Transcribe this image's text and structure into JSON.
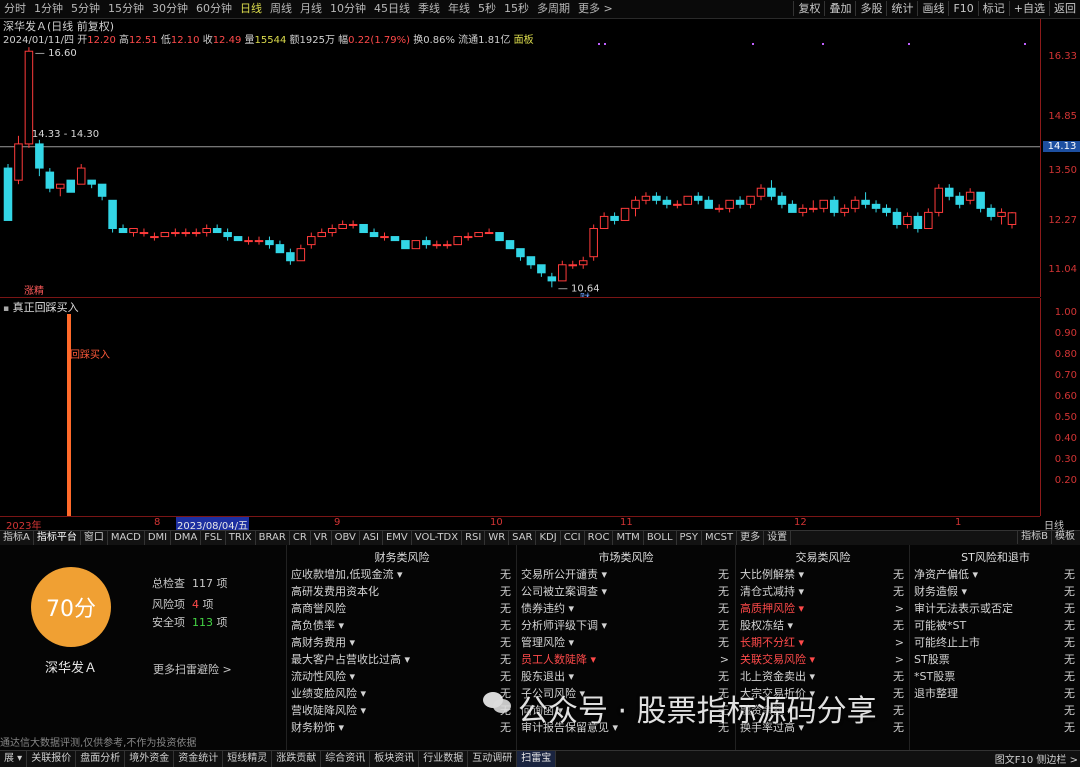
{
  "toolbar": {
    "periods": [
      "分时",
      "1分钟",
      "5分钟",
      "15分钟",
      "30分钟",
      "60分钟",
      "日线",
      "周线",
      "月线",
      "10分钟",
      "45日线",
      "季线",
      "年线",
      "5秒",
      "15秒",
      "多周期",
      "更多 >"
    ],
    "active_period": 6,
    "right_buttons": [
      "复权",
      "叠加",
      "多股",
      "统计",
      "画线",
      "F10",
      "标记",
      "+自选",
      "返回"
    ]
  },
  "chart_header": {
    "title": "深华发Ａ(日线 前复权)",
    "date": "2024/01/11/四",
    "open_label": "开",
    "open": "12.20",
    "high_label": "高",
    "high": "12.51",
    "low_label": "低",
    "low": "12.10",
    "close_label": "收",
    "close": "12.49",
    "volume_label": "量",
    "volume": "15544",
    "amount_label": "额",
    "amount": "1925万",
    "change_label": "幅",
    "change": "0.22(1.79%)",
    "turnover_label": "换",
    "turnover": "0.86%",
    "float_label": "流通",
    "float_value": "1.81亿",
    "board": "面板"
  },
  "price_axis": {
    "ticks": [
      "16.33",
      "14.85",
      "13.50",
      "12.27",
      "11.04"
    ],
    "current_price": "14.13"
  },
  "annotations": {
    "high_label": "16.60",
    "line_label": "14.33 - 14.30",
    "low_label": "10.64",
    "low_badge": "财",
    "limit_up_badge": "涨精"
  },
  "indicator": {
    "title": "真正回踩买入",
    "signal_label": "回踩买入",
    "axis_ticks": [
      "1.00",
      "0.90",
      "0.80",
      "0.70",
      "0.60",
      "0.50",
      "0.40",
      "0.30",
      "0.20"
    ]
  },
  "date_axis": {
    "labels": [
      "2023年",
      "8",
      "9",
      "10",
      "11",
      "12",
      "1"
    ],
    "selected_date": "2023/08/04/五",
    "period_name": "日线"
  },
  "indicator_tabs": [
    "指标A",
    "指标平台",
    "窗口",
    "MACD",
    "DMI",
    "DMA",
    "FSL",
    "TRIX",
    "BRAR",
    "CR",
    "VR",
    "OBV",
    "ASI",
    "EMV",
    "VOL-TDX",
    "RSI",
    "WR",
    "SAR",
    "KDJ",
    "CCI",
    "ROC",
    "MTM",
    "BOLL",
    "PSY",
    "MCST",
    "更多",
    "设置"
  ],
  "indicator_tabs_right": [
    "指标B",
    "模板"
  ],
  "risk": {
    "score": "70分",
    "stock_name": "深华发Ａ",
    "total_label": "总检查",
    "total_value": "117",
    "total_unit": "项",
    "risk_label": "风险项",
    "risk_value": "4",
    "risk_unit": "项",
    "safe_label": "安全项",
    "safe_value": "113",
    "safe_unit": "项",
    "more_label": "更多扫雷避险  >",
    "disclaimer": "通达信大数据评测,仅供参考,不作为投资依据",
    "columns": [
      {
        "title": "财务类风险",
        "rows": [
          {
            "label": "应收款增加,低现金流 ▾",
            "value": "无",
            "red": false
          },
          {
            "label": "高研发费用资本化",
            "value": "无",
            "red": false
          },
          {
            "label": "高商誉风险",
            "value": "无",
            "red": false
          },
          {
            "label": "高负债率 ▾",
            "value": "无",
            "red": false
          },
          {
            "label": "高财务费用 ▾",
            "value": "无",
            "red": false
          },
          {
            "label": "最大客户占营收比过高 ▾",
            "value": "无",
            "red": false
          },
          {
            "label": "流动性风险 ▾",
            "value": "无",
            "red": false
          },
          {
            "label": "业绩变脸风险 ▾",
            "value": "无",
            "red": false
          },
          {
            "label": "营收陡降风险 ▾",
            "value": "无",
            "red": false
          },
          {
            "label": "财务粉饰 ▾",
            "value": "无",
            "red": false
          }
        ]
      },
      {
        "title": "市场类风险",
        "rows": [
          {
            "label": "交易所公开谴责 ▾",
            "value": "无",
            "red": false
          },
          {
            "label": "公司被立案调查 ▾",
            "value": "无",
            "red": false
          },
          {
            "label": "债券违约 ▾",
            "value": "无",
            "red": false
          },
          {
            "label": "分析师评级下调 ▾",
            "value": "无",
            "red": false
          },
          {
            "label": "管理风险 ▾",
            "value": "无",
            "red": false
          },
          {
            "label": "员工人数陡降 ▾",
            "value": ">",
            "red": true
          },
          {
            "label": "股东退出 ▾",
            "value": "无",
            "red": false
          },
          {
            "label": "子公司风险 ▾",
            "value": "无",
            "red": false
          },
          {
            "label": "问询函 ▾",
            "value": "无",
            "red": false
          },
          {
            "label": "审计报告保留意见 ▾",
            "value": "无",
            "red": false
          }
        ]
      },
      {
        "title": "交易类风险",
        "rows": [
          {
            "label": "大比例解禁 ▾",
            "value": "无",
            "red": false
          },
          {
            "label": "清仓式减持 ▾",
            "value": "无",
            "red": false
          },
          {
            "label": "高质押风险 ▾",
            "value": ">",
            "red": true
          },
          {
            "label": "股权冻结 ▾",
            "value": "无",
            "red": false
          },
          {
            "label": "长期不分红 ▾",
            "value": ">",
            "red": true
          },
          {
            "label": "关联交易风险 ▾",
            "value": ">",
            "red": true
          },
          {
            "label": "北上资金卖出 ▾",
            "value": "无",
            "red": false
          },
          {
            "label": "大宗交易折价 ▾",
            "value": "无",
            "red": false
          },
          {
            "label": "融资余额 ▾",
            "value": "无",
            "red": false
          },
          {
            "label": "换手率过高 ▾",
            "value": "无",
            "red": false
          }
        ]
      },
      {
        "title": "ST风险和退市",
        "rows": [
          {
            "label": "净资产偏低 ▾",
            "value": "无",
            "red": false
          },
          {
            "label": "财务造假 ▾",
            "value": "无",
            "red": false
          },
          {
            "label": "审计无法表示或否定",
            "value": "无",
            "red": false
          },
          {
            "label": "可能被*ST",
            "value": "无",
            "red": false
          },
          {
            "label": "可能终止上市",
            "value": "无",
            "red": false
          },
          {
            "label": "ST股票",
            "value": "无",
            "red": false
          },
          {
            "label": "*ST股票",
            "value": "无",
            "red": false
          },
          {
            "label": "退市整理",
            "value": "无",
            "red": false
          },
          {
            "label": "",
            "value": "无",
            "red": false
          },
          {
            "label": "",
            "value": "无",
            "red": false
          }
        ]
      }
    ]
  },
  "bottom_bar": [
    "展 ▾",
    "关联报价",
    "盘面分析",
    "境外资金",
    "资金统计",
    "短线精灵",
    "涨跌贡献",
    "综合资讯",
    "板块资讯",
    "行业数据",
    "互动调研",
    "扫雷宝"
  ],
  "bottom_bar_active": 11,
  "bottom_right": "图文F10  侧边栏 >",
  "watermark": "公众号 · 股票指标源码分享",
  "colors": {
    "up": "#ff3b3b",
    "down": "#33d6e6",
    "score": "#f0a033",
    "axis": "#d23434",
    "selected": "#1d2fa0"
  },
  "chart_data": {
    "type": "candlestick",
    "title": "深华发Ａ(日线 前复权)",
    "ylim": [
      10.4,
      17.3
    ],
    "y_ticks": [
      16.33,
      14.85,
      13.5,
      12.27,
      11.04
    ],
    "candles": [
      [
        13.6,
        13.7,
        12.3,
        12.3
      ],
      [
        13.3,
        14.4,
        13.2,
        14.2
      ],
      [
        14.2,
        16.6,
        14.1,
        16.5
      ],
      [
        14.2,
        14.3,
        13.4,
        13.6
      ],
      [
        13.5,
        13.6,
        13.0,
        13.1
      ],
      [
        13.1,
        13.2,
        12.9,
        13.2
      ],
      [
        13.3,
        13.3,
        13.0,
        13.0
      ],
      [
        13.2,
        13.7,
        13.2,
        13.6
      ],
      [
        13.3,
        13.3,
        13.1,
        13.2
      ],
      [
        13.2,
        13.2,
        12.8,
        12.9
      ],
      [
        12.8,
        12.8,
        12.0,
        12.1
      ],
      [
        12.1,
        12.2,
        12.0,
        12.0
      ],
      [
        12.0,
        12.1,
        11.9,
        12.1
      ],
      [
        12.0,
        12.1,
        11.9,
        12.0
      ],
      [
        11.9,
        12.0,
        11.8,
        11.9
      ],
      [
        11.9,
        12.0,
        11.9,
        12.0
      ],
      [
        12.0,
        12.1,
        11.9,
        12.0
      ],
      [
        12.0,
        12.1,
        11.9,
        12.0
      ],
      [
        12.0,
        12.1,
        11.9,
        12.0
      ],
      [
        12.0,
        12.2,
        11.9,
        12.1
      ],
      [
        12.1,
        12.2,
        12.0,
        12.0
      ],
      [
        12.0,
        12.1,
        11.8,
        11.9
      ],
      [
        11.9,
        11.9,
        11.8,
        11.8
      ],
      [
        11.8,
        11.9,
        11.7,
        11.8
      ],
      [
        11.8,
        11.9,
        11.7,
        11.8
      ],
      [
        11.8,
        11.9,
        11.6,
        11.7
      ],
      [
        11.7,
        11.8,
        11.5,
        11.5
      ],
      [
        11.5,
        11.6,
        11.2,
        11.3
      ],
      [
        11.3,
        11.7,
        11.3,
        11.6
      ],
      [
        11.7,
        12.0,
        11.6,
        11.9
      ],
      [
        11.9,
        12.1,
        11.9,
        12.0
      ],
      [
        12.0,
        12.2,
        11.9,
        12.1
      ],
      [
        12.1,
        12.3,
        12.1,
        12.2
      ],
      [
        12.2,
        12.3,
        12.1,
        12.2
      ],
      [
        12.2,
        12.2,
        12.0,
        12.0
      ],
      [
        12.0,
        12.1,
        11.9,
        11.9
      ],
      [
        11.9,
        12.0,
        11.8,
        11.9
      ],
      [
        11.9,
        11.9,
        11.8,
        11.8
      ],
      [
        11.8,
        11.8,
        11.6,
        11.6
      ],
      [
        11.6,
        11.8,
        11.6,
        11.8
      ],
      [
        11.8,
        11.9,
        11.6,
        11.7
      ],
      [
        11.7,
        11.8,
        11.6,
        11.7
      ],
      [
        11.7,
        11.8,
        11.6,
        11.7
      ],
      [
        11.7,
        11.9,
        11.7,
        11.9
      ],
      [
        11.9,
        12.0,
        11.8,
        11.9
      ],
      [
        11.9,
        12.0,
        11.9,
        12.0
      ],
      [
        12.0,
        12.1,
        12.0,
        12.0
      ],
      [
        12.0,
        12.0,
        11.8,
        11.8
      ],
      [
        11.8,
        11.8,
        11.6,
        11.6
      ],
      [
        11.6,
        11.6,
        11.3,
        11.4
      ],
      [
        11.4,
        11.4,
        11.1,
        11.2
      ],
      [
        11.2,
        11.2,
        10.9,
        11.0
      ],
      [
        10.9,
        11.0,
        10.64,
        10.8
      ],
      [
        10.8,
        11.3,
        10.8,
        11.2
      ],
      [
        11.2,
        11.3,
        11.1,
        11.2
      ],
      [
        11.2,
        11.4,
        11.1,
        11.3
      ],
      [
        11.4,
        12.2,
        11.3,
        12.1
      ],
      [
        12.1,
        12.5,
        12.1,
        12.4
      ],
      [
        12.4,
        12.5,
        12.2,
        12.3
      ],
      [
        12.3,
        12.6,
        12.3,
        12.6
      ],
      [
        12.6,
        12.9,
        12.4,
        12.8
      ],
      [
        12.8,
        13.0,
        12.7,
        12.9
      ],
      [
        12.9,
        13.0,
        12.7,
        12.8
      ],
      [
        12.8,
        12.9,
        12.6,
        12.7
      ],
      [
        12.7,
        12.8,
        12.6,
        12.7
      ],
      [
        12.7,
        12.9,
        12.7,
        12.9
      ],
      [
        12.9,
        13.0,
        12.7,
        12.8
      ],
      [
        12.8,
        12.9,
        12.6,
        12.6
      ],
      [
        12.6,
        12.7,
        12.5,
        12.6
      ],
      [
        12.6,
        12.8,
        12.5,
        12.8
      ],
      [
        12.8,
        12.9,
        12.6,
        12.7
      ],
      [
        12.7,
        12.9,
        12.6,
        12.9
      ],
      [
        12.9,
        13.2,
        12.8,
        13.1
      ],
      [
        13.1,
        13.3,
        12.8,
        12.9
      ],
      [
        12.9,
        13.0,
        12.6,
        12.7
      ],
      [
        12.7,
        12.8,
        12.5,
        12.5
      ],
      [
        12.5,
        12.7,
        12.4,
        12.6
      ],
      [
        12.6,
        12.8,
        12.5,
        12.6
      ],
      [
        12.6,
        12.8,
        12.5,
        12.8
      ],
      [
        12.8,
        12.9,
        12.4,
        12.5
      ],
      [
        12.5,
        12.7,
        12.4,
        12.6
      ],
      [
        12.6,
        12.9,
        12.5,
        12.8
      ],
      [
        12.8,
        13.0,
        12.6,
        12.7
      ],
      [
        12.7,
        12.8,
        12.5,
        12.6
      ],
      [
        12.6,
        12.7,
        12.4,
        12.5
      ],
      [
        12.5,
        12.6,
        12.1,
        12.2
      ],
      [
        12.2,
        12.5,
        12.1,
        12.4
      ],
      [
        12.4,
        12.5,
        12.0,
        12.1
      ],
      [
        12.1,
        12.6,
        12.1,
        12.5
      ],
      [
        12.5,
        13.2,
        12.4,
        13.1
      ],
      [
        13.1,
        13.2,
        12.8,
        12.9
      ],
      [
        12.9,
        13.0,
        12.6,
        12.7
      ],
      [
        12.8,
        13.1,
        12.7,
        13.0
      ],
      [
        13.0,
        13.0,
        12.5,
        12.6
      ],
      [
        12.6,
        12.7,
        12.3,
        12.4
      ],
      [
        12.4,
        12.6,
        12.2,
        12.5
      ],
      [
        12.2,
        12.51,
        12.1,
        12.49
      ]
    ],
    "signal_index": 2,
    "signal_value": 1.0
  }
}
